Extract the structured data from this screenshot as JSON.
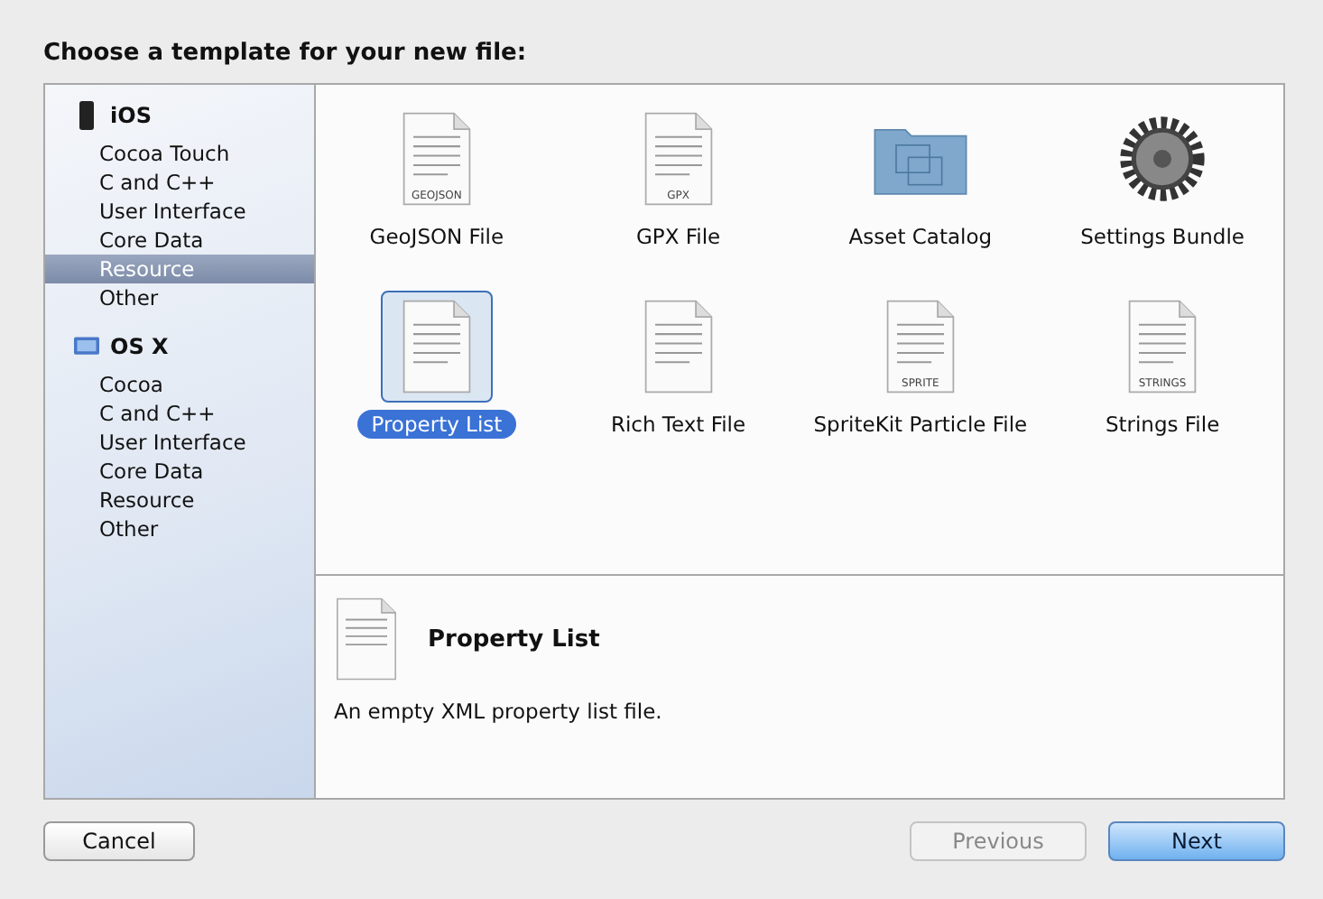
{
  "title": "Choose a template for your new file:",
  "sidebar": [
    {
      "platform": "iOS",
      "kind": "phone",
      "items": [
        {
          "label": "Cocoa Touch",
          "selected": false
        },
        {
          "label": "C and C++",
          "selected": false
        },
        {
          "label": "User Interface",
          "selected": false
        },
        {
          "label": "Core Data",
          "selected": false
        },
        {
          "label": "Resource",
          "selected": true
        },
        {
          "label": "Other",
          "selected": false
        }
      ]
    },
    {
      "platform": "OS X",
      "kind": "desktop",
      "items": [
        {
          "label": "Cocoa",
          "selected": false
        },
        {
          "label": "C and C++",
          "selected": false
        },
        {
          "label": "User Interface",
          "selected": false
        },
        {
          "label": "Core Data",
          "selected": false
        },
        {
          "label": "Resource",
          "selected": false
        },
        {
          "label": "Other",
          "selected": false
        }
      ]
    }
  ],
  "templates": [
    {
      "label": "GeoJSON File",
      "kind": "document",
      "badge": "GEOJSON",
      "selected": false
    },
    {
      "label": "GPX File",
      "kind": "document",
      "badge": "GPX",
      "selected": false
    },
    {
      "label": "Asset Catalog",
      "kind": "folder",
      "selected": false
    },
    {
      "label": "Settings Bundle",
      "kind": "gear",
      "selected": false
    },
    {
      "label": "Property List",
      "kind": "document",
      "selected": true
    },
    {
      "label": "Rich Text File",
      "kind": "document",
      "selected": false
    },
    {
      "label": "SpriteKit Particle File",
      "kind": "document",
      "badge": "SPRITE",
      "selected": false
    },
    {
      "label": "Strings File",
      "kind": "document",
      "badge": "STRINGS",
      "selected": false
    }
  ],
  "detail": {
    "title": "Property List",
    "description": "An empty XML property list file."
  },
  "buttons": [
    {
      "label": "Cancel",
      "disabled": false,
      "default": false
    },
    {
      "label": "Previous",
      "disabled": true,
      "default": false
    },
    {
      "label": "Next",
      "disabled": false,
      "default": true
    }
  ]
}
